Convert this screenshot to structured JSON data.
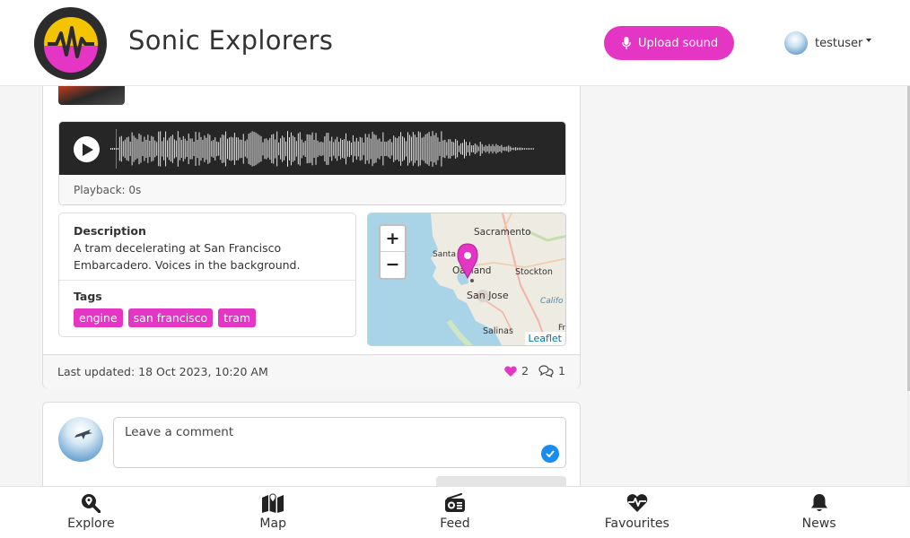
{
  "header": {
    "brand": "Sonic Explorers",
    "upload_label": "Upload sound",
    "username": "testuser"
  },
  "sound": {
    "playback": "Playback: 0s",
    "description_label": "Description",
    "description": "A tram decelerating at San Francisco Embarcadero. Voices in the background.",
    "tags_label": "Tags",
    "tags": [
      "engine",
      "san francisco",
      "tram"
    ],
    "last_updated": "Last updated: 18 Oct 2023, 10:20 AM",
    "likes": "2",
    "comments": "1"
  },
  "map": {
    "zoom_in": "+",
    "zoom_out": "−",
    "attribution": "Leaflet",
    "places": [
      "Sacramento",
      "Santa",
      "Oakland",
      "Stockton",
      "San Jose",
      "Califo",
      "Salinas",
      "Fr"
    ]
  },
  "comment": {
    "placeholder": "Leave a comment"
  },
  "bottom_nav": {
    "explore": "Explore",
    "map": "Map",
    "feed": "Feed",
    "favourites": "Favourites",
    "news": "News"
  },
  "colors": {
    "accent": "#e535c5",
    "check": "#1a8cf0",
    "logo_yellow": "#f5c400",
    "logo_dark": "#2c2c2c"
  }
}
